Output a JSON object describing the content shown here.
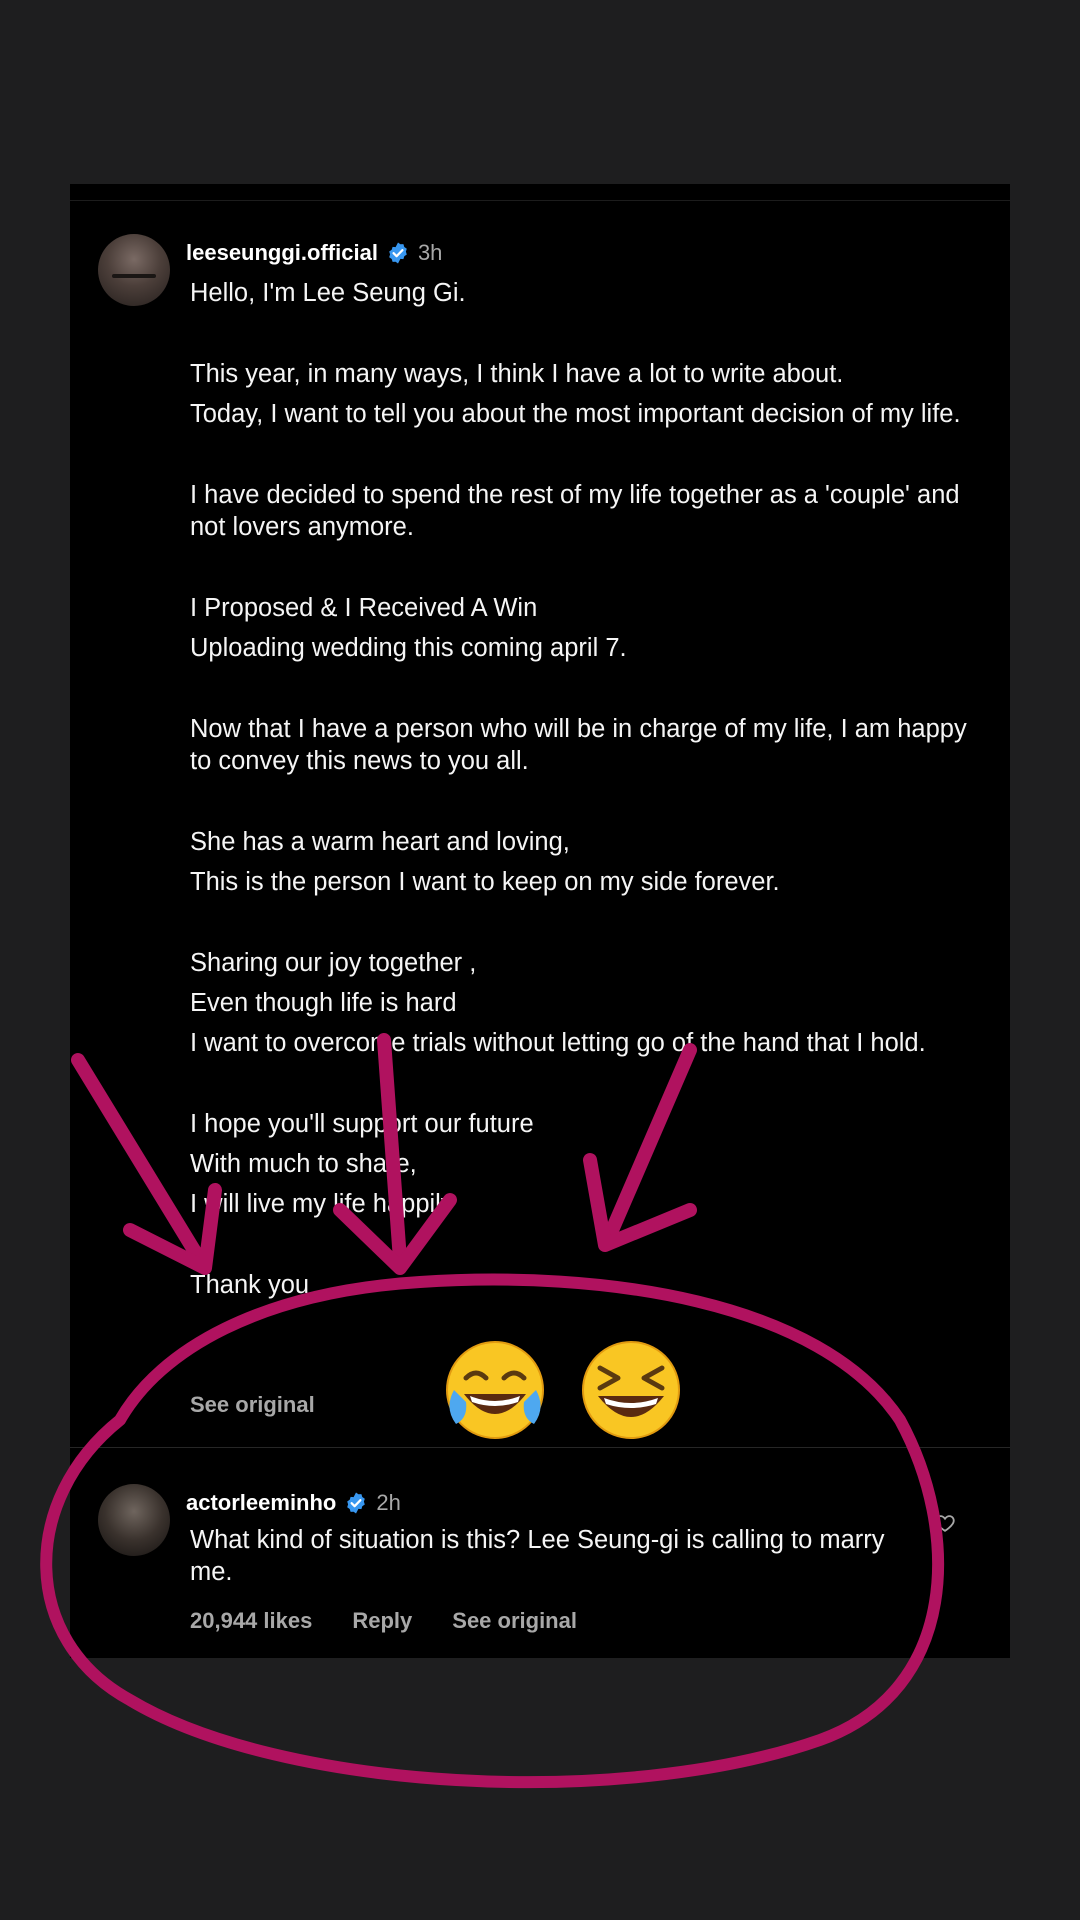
{
  "post": {
    "username": "leeseunggi.official",
    "time": "3h",
    "lines": [
      "Hello, I'm Lee Seung Gi.",
      "This year, in many ways, I think I have a lot to write about.",
      "Today, I want to tell you about the most important decision of my life.",
      "I have decided to spend the rest of my life together as a 'couple' and not lovers anymore.",
      "I Proposed & I Received A Win",
      "Uploading wedding this coming april 7.",
      "Now that I have a person who will be in charge of my life, I am happy to convey this news to you all.",
      "She has a warm heart and loving,",
      "This is the person I want to keep on my side forever.",
      "Sharing our joy together ,",
      "Even though life is hard",
      "I want to overcome trials without letting go of the hand that I hold.",
      "I hope you'll support our future",
      "With much to share,",
      "I will live my life happily",
      "Thank you"
    ],
    "see_original": "See original"
  },
  "comment": {
    "username": "actorleeminho",
    "time": "2h",
    "text": "What kind of situation is this? Lee Seung-gi is calling to marry me.",
    "likes": "20,944 likes",
    "reply": "Reply",
    "see_original": "See original"
  },
  "annotation": {
    "emojis": [
      "face-with-tears-of-joy",
      "grinning-squinting-face"
    ],
    "ink_color": "#b0125f",
    "arrow_count": 4
  },
  "colors": {
    "background": "#1e1e1f",
    "panel": "#000000",
    "verified": "#3897f0",
    "muted": "#a8a8a8"
  }
}
